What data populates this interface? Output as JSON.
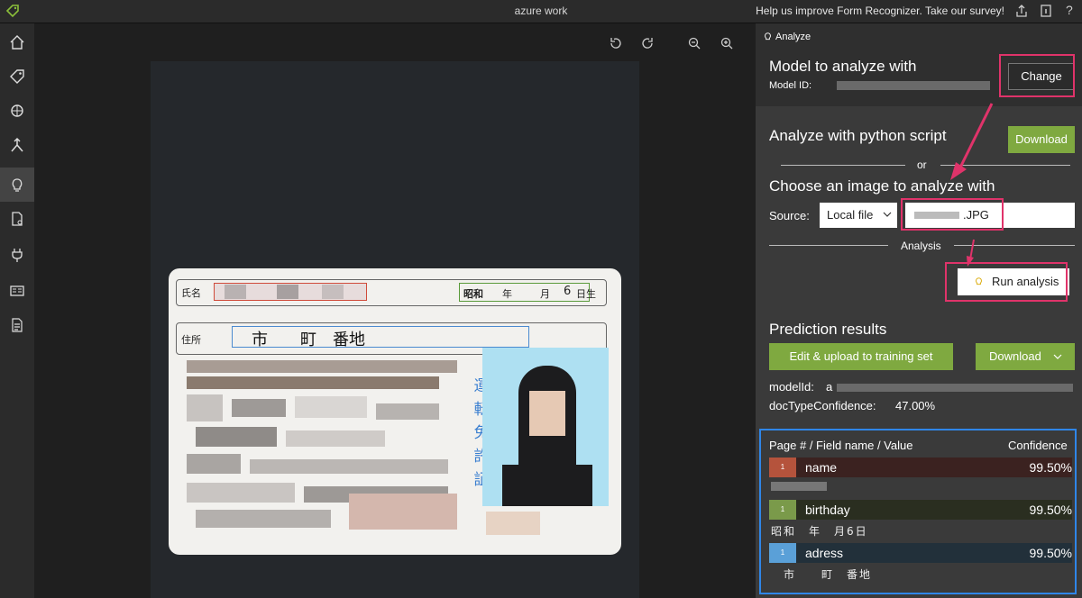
{
  "window": {
    "title": "azure work",
    "survey_link": "Help us improve Form Recognizer. Take our survey!"
  },
  "top_icons": [
    "tag-logo-icon",
    "share-icon",
    "info-icon",
    "help-icon"
  ],
  "sidebar": {
    "items": [
      {
        "icon": "home-icon"
      },
      {
        "icon": "tag-icon"
      },
      {
        "icon": "train-icon"
      },
      {
        "icon": "merge-icon"
      },
      {
        "icon": "lightbulb-icon",
        "active": true
      },
      {
        "icon": "document-settings-icon"
      },
      {
        "icon": "plug-icon"
      },
      {
        "icon": "id-card-icon"
      },
      {
        "icon": "document-list-icon"
      }
    ]
  },
  "canvas": {
    "tools": [
      "rotate-left-icon",
      "rotate-right-icon",
      "zoom-out-icon",
      "zoom-in-icon"
    ],
    "card": {
      "name_label": "氏名",
      "birth_era": "昭和",
      "birth_year_unit": "年",
      "birth_month_unit": "月",
      "birth_day": "6",
      "birth_day_unit": "日生",
      "address_label": "住所",
      "address_text": "市　　町　番地",
      "side_text": "運転免許証"
    }
  },
  "panel": {
    "header": "Analyze",
    "model_title": "Model to analyze with",
    "model_id_label": "Model ID:",
    "change_label": "Change",
    "python_title": "Analyze with python script",
    "download_label": "Download",
    "or_label": "or",
    "choose_title": "Choose an image to analyze with",
    "source_label": "Source:",
    "source_value": "Local file",
    "file_value": ".JPG",
    "analysis_label": "Analysis",
    "run_label": "Run analysis",
    "prediction_title": "Prediction results",
    "edit_upload_label": "Edit & upload to training set",
    "download2_label": "Download",
    "model_id_result_label": "modelId:",
    "model_id_result_value": "a",
    "doc_conf_label": "docTypeConfidence:",
    "doc_conf_value": "47.00%",
    "table": {
      "col1": "Page # / Field name / Value",
      "col2": "Confidence",
      "rows": [
        {
          "page": "1",
          "name": "name",
          "confidence": "99.50%",
          "value": "",
          "color": "#b5533c",
          "bg": "#3b2220"
        },
        {
          "page": "1",
          "name": "birthday",
          "confidence": "99.50%",
          "value": "昭和　年　月6日",
          "color": "#7a9a4a",
          "bg": "#2a2e20"
        },
        {
          "page": "1",
          "name": "adress",
          "confidence": "99.50%",
          "value": "　市　　町　番地",
          "color": "#5aa0d8",
          "bg": "#22303a"
        }
      ]
    }
  },
  "colors": {
    "accent_green": "#7fa940",
    "highlight_red": "#e0336a",
    "highlight_blue": "#2f86e8"
  }
}
